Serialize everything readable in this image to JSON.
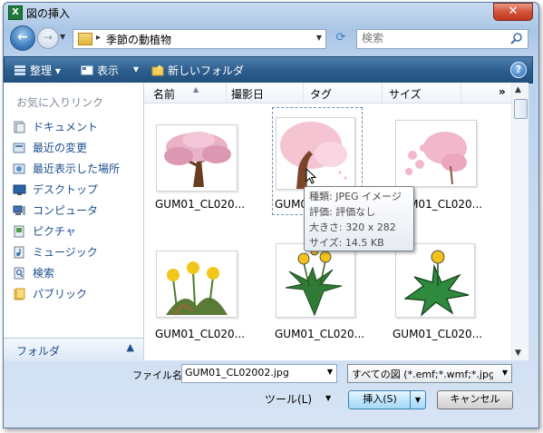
{
  "window": {
    "title": "図の挿入",
    "close": "✕"
  },
  "address": {
    "path": "季節の動植物",
    "search_placeholder": "検索"
  },
  "toolbar": {
    "organize": "整理",
    "views": "表示",
    "new_folder": "新しいフォルダ",
    "help": "?"
  },
  "nav": {
    "favorites_title": "お気に入りリンク",
    "items": [
      "ドキュメント",
      "最近の変更",
      "最近表示した場所",
      "デスクトップ",
      "コンピュータ",
      "ピクチャ",
      "ミュージック",
      "検索",
      "パブリック"
    ],
    "folders_label": "フォルダ"
  },
  "columns": {
    "name": "名前",
    "date": "撮影日",
    "tags": "タグ",
    "size": "サイズ",
    "more": "»"
  },
  "files": [
    {
      "label": "GUM01_CL020...",
      "image": "cherry-tree-brown-trunk"
    },
    {
      "label": "GUM01_CL020...",
      "image": "cherry-blossom-selected"
    },
    {
      "label": "GUM01_CL020...",
      "image": "cherry-blossom-clusters"
    },
    {
      "label": "GUM01_CL020...",
      "image": "yellow-dandelions"
    },
    {
      "label": "GUM01_CL020...",
      "image": "dandelion-plant"
    },
    {
      "label": "GUM01_CL020...",
      "image": "dandelion-leaves"
    }
  ],
  "selected_label": "GUM0",
  "tooltip": {
    "type": "種類: JPEG イメージ",
    "rating": "評価: 評価なし",
    "dimensions": "大きさ: 320 x 282",
    "size": "サイズ: 14.5 KB"
  },
  "bottom": {
    "filename_label": "ファイル名(N):",
    "filename_value": "GUM01_CL02002.jpg",
    "filter_value": "すべての図 (*.emf;*.wmf;*.jpg;*.jpe",
    "tools_label": "ツール(L)",
    "insert_label": "挿入(S)",
    "cancel_label": "キャンセル"
  },
  "colors": {
    "toolbar": "#2e5f8f",
    "link": "#1c4f8c",
    "close": "#c1361b"
  }
}
